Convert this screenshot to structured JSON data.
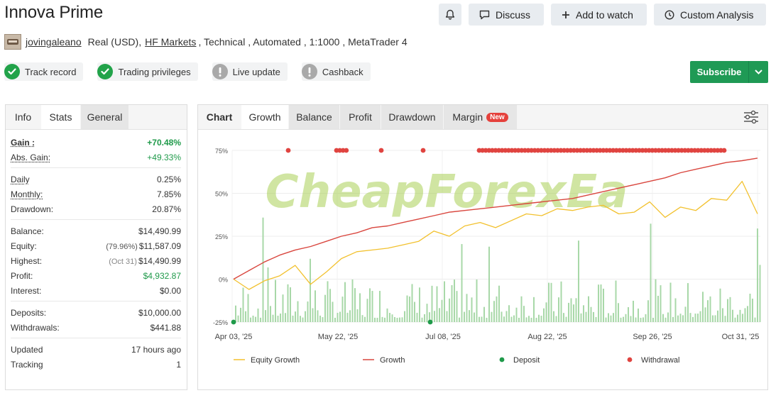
{
  "header": {
    "title": "Innova Prime",
    "buttons": {
      "discuss": "Discuss",
      "add_watch": "Add to watch",
      "custom_analysis": "Custom Analysis"
    },
    "user": "jovingaleano",
    "account_prefix": "Real (USD),",
    "broker": "HF Markets",
    "account_suffix": ", Technical , Automated , 1:1000 , MetaTrader 4"
  },
  "badges": [
    {
      "label": "Track record",
      "status": "ok",
      "icon": "check-icon"
    },
    {
      "label": "Trading privileges",
      "status": "ok",
      "icon": "check-icon"
    },
    {
      "label": "Live update",
      "status": "warn",
      "icon": "exclamation-icon"
    },
    {
      "label": "Cashback",
      "status": "warn",
      "icon": "exclamation-icon"
    }
  ],
  "subscribe": {
    "label": "Subscribe"
  },
  "left_tabs": [
    "Info",
    "Stats",
    "General"
  ],
  "stats": {
    "gain": {
      "label": "Gain :",
      "value": "+70.48%"
    },
    "abs_gain": {
      "label": "Abs. Gain:",
      "value": "+49.33%"
    },
    "daily": {
      "label": "Daily",
      "value": "0.25%"
    },
    "monthly": {
      "label": "Monthly:",
      "value": "7.85%"
    },
    "drawdown": {
      "label": "Drawdown:",
      "value": "20.87%"
    },
    "balance": {
      "label": "Balance:",
      "value": "$14,490.99"
    },
    "equity": {
      "label": "Equity:",
      "note": "(79.96%)",
      "value": "$11,587.09"
    },
    "highest": {
      "label": "Highest:",
      "note": "(Oct 31)",
      "value": "$14,490.99"
    },
    "profit": {
      "label": "Profit:",
      "value": "$4,932.87"
    },
    "interest": {
      "label": "Interest:",
      "value": "$0.00"
    },
    "deposits": {
      "label": "Deposits:",
      "value": "$10,000.00"
    },
    "withdrawals": {
      "label": "Withdrawals:",
      "value": "$441.88"
    },
    "updated": {
      "label": "Updated",
      "value": "17 hours ago"
    },
    "tracking": {
      "label": "Tracking",
      "value": "1"
    }
  },
  "chart_tabs": {
    "chart": "Chart",
    "growth": "Growth",
    "balance": "Balance",
    "profit": "Profit",
    "drawdown": "Drawdown",
    "margin": "Margin",
    "margin_badge": "New"
  },
  "watermark": "CheapForexEa",
  "colors": {
    "growth": "#d9463e",
    "equity": "#f2c12e",
    "deposit": "#1f9a4a",
    "withdrawal": "#e04440",
    "bars": "#a8d8a8",
    "subscribe": "#1f9a55"
  },
  "chart_data": {
    "type": "line",
    "y_ticks": [
      "75%",
      "50%",
      "25%",
      "0%",
      "-25%"
    ],
    "ylim": [
      -25,
      75
    ],
    "x_ticks": [
      "Apr 03, '25",
      "May 22, '25",
      "Jul 08, '25",
      "Aug 22, '25",
      "Sep 26, '25",
      "Oct 31, '25"
    ],
    "series": [
      {
        "name": "Growth",
        "values": [
          0,
          5,
          10,
          14,
          17,
          19,
          22,
          25,
          27,
          30,
          31,
          33,
          35,
          37,
          39,
          40,
          41,
          42,
          43,
          44,
          45,
          46,
          47,
          49,
          51,
          53,
          55,
          57,
          59,
          62,
          64,
          66,
          68,
          69,
          70.5
        ]
      },
      {
        "name": "Equity Growth",
        "values": [
          0,
          -6,
          -1,
          2,
          8,
          -3,
          4,
          12,
          16,
          17,
          18,
          20,
          22,
          28,
          25,
          31,
          33,
          30,
          34,
          38,
          37,
          41,
          40,
          42,
          43,
          38,
          39,
          45,
          36,
          42,
          40,
          47,
          46,
          57,
          38
        ]
      }
    ],
    "legend": [
      "Equity Growth",
      "Growth",
      "Deposit",
      "Withdrawal"
    ],
    "legend_placement": "bottom"
  }
}
